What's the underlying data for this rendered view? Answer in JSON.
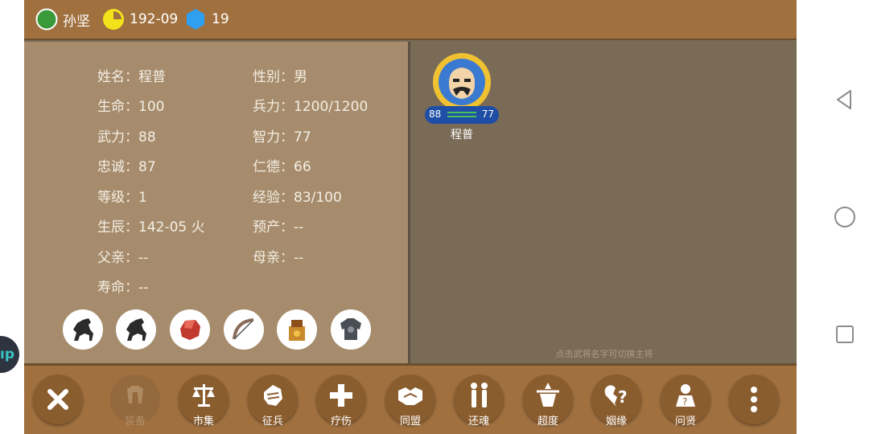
{
  "topbar": {
    "ruler": "孙坚",
    "date": "192-09",
    "resource": "19"
  },
  "general": {
    "fields": [
      {
        "label": "姓名：",
        "value": "程普"
      },
      {
        "label": "性别：",
        "value": "男"
      },
      {
        "label": "生命：",
        "value": "100"
      },
      {
        "label": "兵力：",
        "value": "1200/1200"
      },
      {
        "label": "武力：",
        "value": "88"
      },
      {
        "label": "智力：",
        "value": "77"
      },
      {
        "label": "忠诚：",
        "value": "87"
      },
      {
        "label": "仁德：",
        "value": "66"
      },
      {
        "label": "等级：",
        "value": "1"
      },
      {
        "label": "经验：",
        "value": "83/100"
      },
      {
        "label": "生辰：",
        "value": "142-05 火"
      },
      {
        "label": "预产：",
        "value": "--"
      },
      {
        "label": "父亲：",
        "value": "--"
      },
      {
        "label": "母亲：",
        "value": "--"
      },
      {
        "label": "寿命：",
        "value": "--"
      }
    ],
    "equipment": [
      "horse-icon",
      "horse-icon",
      "gem-icon",
      "bow-icon",
      "treasure-icon",
      "armor-icon"
    ]
  },
  "roster": {
    "name": "程普",
    "stat_left": "88",
    "stat_right": "77",
    "hint": "点击武将名字可切换主将"
  },
  "actions": [
    {
      "label": "",
      "icon": "close-icon"
    },
    {
      "label": "装备",
      "icon": "equipment-icon",
      "disabled": true
    },
    {
      "label": "市集",
      "icon": "scale-icon"
    },
    {
      "label": "征兵",
      "icon": "fist-icon"
    },
    {
      "label": "疗伤",
      "icon": "plus-icon"
    },
    {
      "label": "同盟",
      "icon": "handshake-icon"
    },
    {
      "label": "还魂",
      "icon": "revive-icon"
    },
    {
      "label": "超度",
      "icon": "incense-icon"
    },
    {
      "label": "姻缘",
      "icon": "broken-heart-icon"
    },
    {
      "label": "问贤",
      "icon": "sage-icon"
    },
    {
      "label": "",
      "icon": "more-icon"
    }
  ],
  "colors": {
    "bar": "#a0703f",
    "panel": "#a68c6c",
    "button": "#8a5d2f",
    "stat_pill": "#1e4ea6",
    "gold": "#f0c232"
  },
  "edge_badge": "ıp"
}
